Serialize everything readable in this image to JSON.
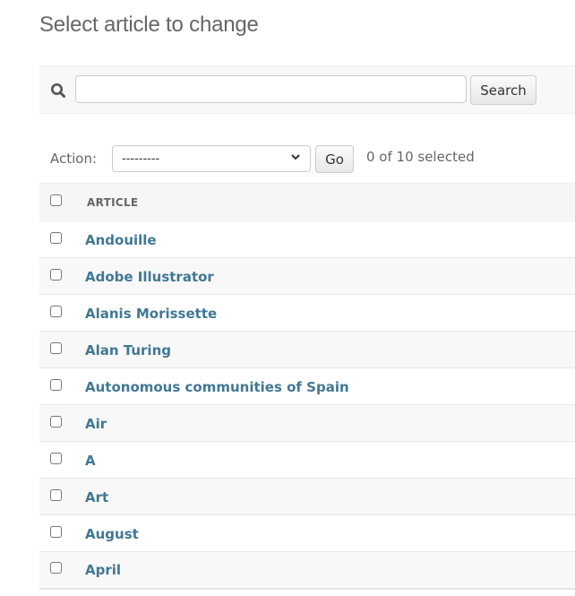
{
  "page": {
    "title": "Select article to change"
  },
  "search": {
    "icon": "search-icon",
    "value": "",
    "placeholder": "",
    "button_label": "Search"
  },
  "actions": {
    "label": "Action:",
    "selected_option": "---------",
    "go_label": "Go",
    "selection_counter": "0 of 10 selected"
  },
  "table": {
    "columns": [
      {
        "label": ""
      },
      {
        "label": "ARTICLE"
      }
    ],
    "rows": [
      {
        "title": "Andouille"
      },
      {
        "title": "Adobe Illustrator"
      },
      {
        "title": "Alanis Morissette"
      },
      {
        "title": "Alan Turing"
      },
      {
        "title": "Autonomous communities of Spain"
      },
      {
        "title": "Air"
      },
      {
        "title": "A"
      },
      {
        "title": "Art"
      },
      {
        "title": "August"
      },
      {
        "title": "April"
      }
    ]
  },
  "colors": {
    "link": "#417893",
    "header_bg": "#f6f6f6",
    "stripe_bg": "#f8f8f8"
  }
}
